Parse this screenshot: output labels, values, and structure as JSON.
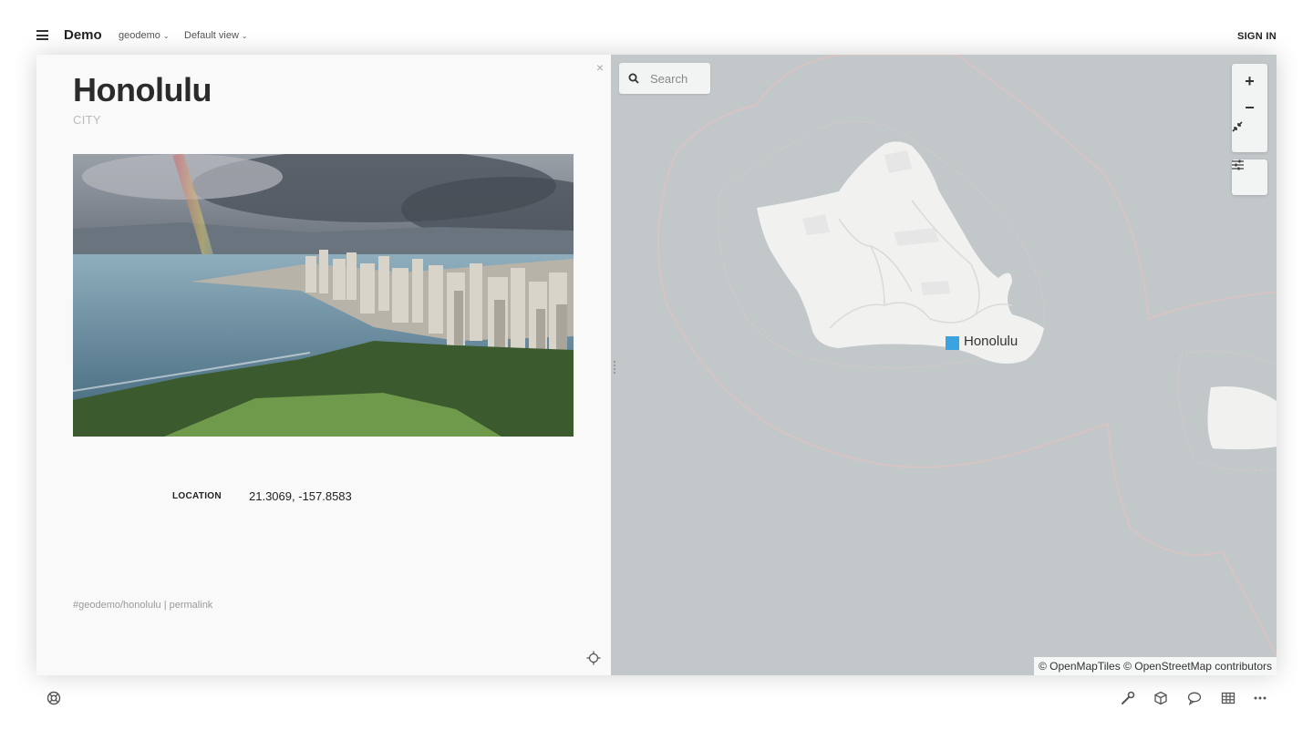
{
  "header": {
    "app_title": "Demo",
    "space_selector": "geodemo",
    "view_selector": "Default view",
    "sign_in": "SIGN IN"
  },
  "panel": {
    "title": "Honolulu",
    "subtitle": "CITY",
    "close": "×",
    "fields": {
      "location_label": "LOCATION",
      "location_value": "21.3069, -157.8583"
    },
    "footer": {
      "hash": "#geodemo/honolulu",
      "separator": " | ",
      "permalink": "permalink"
    }
  },
  "map": {
    "search_placeholder": "Search",
    "zoom_in": "+",
    "zoom_out": "−",
    "marker_label": "Honolulu",
    "marker_color": "#3ba3e0",
    "attribution": "© OpenMapTiles © OpenStreetMap contributors"
  },
  "colors": {
    "map_water": "#c2c7ca",
    "map_land": "#f1f1f0",
    "panel_bg": "#f8f9f8"
  }
}
